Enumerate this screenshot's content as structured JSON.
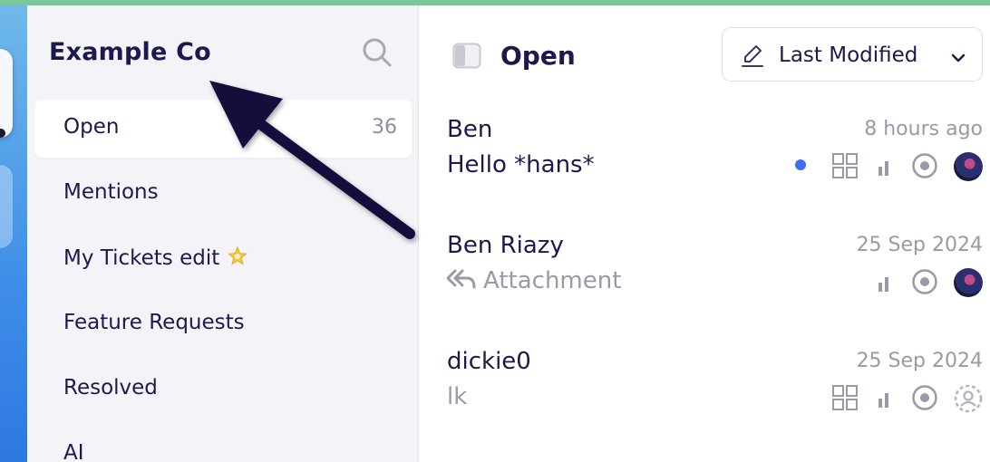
{
  "sidebar": {
    "workspace_name": "Example Co",
    "search_icon": "search-icon",
    "items": [
      {
        "label": "Open",
        "count": "36",
        "active": true
      },
      {
        "label": "Mentions"
      },
      {
        "label": "My Tickets edit",
        "emoji_icon": "sparkle-star-icon"
      },
      {
        "label": "Feature Requests"
      },
      {
        "label": "Resolved"
      },
      {
        "label": "AI"
      }
    ]
  },
  "main": {
    "title": "Open",
    "sort": {
      "label": "Last Modified",
      "icon": "pencil-icon",
      "chevron": "chevron-down-icon"
    },
    "conversations": [
      {
        "name": "Ben",
        "time": "8 hours ago",
        "preview": "Hello *hans*",
        "unread": true,
        "icons": [
          "grid-icon",
          "priority-bars-icon",
          "status-open-icon",
          "avatar"
        ]
      },
      {
        "name": "Ben Riazy",
        "time": "25 Sep 2024",
        "preview": "Attachment",
        "preview_icon": "reply-all-icon",
        "icons": [
          "priority-bars-icon",
          "status-open-icon",
          "avatar"
        ]
      },
      {
        "name": "dickie0",
        "time": "25 Sep 2024",
        "preview": "lk",
        "icons": [
          "grid-icon",
          "priority-bars-icon",
          "status-open-icon",
          "unassigned-user-icon"
        ]
      }
    ]
  },
  "colors": {
    "accent_strip": "#7cc79a",
    "text_primary": "#1c1a4d",
    "text_muted": "#9a99a8",
    "unread_dot": "#3c6ef0",
    "annotation_arrow": "#15103d"
  }
}
